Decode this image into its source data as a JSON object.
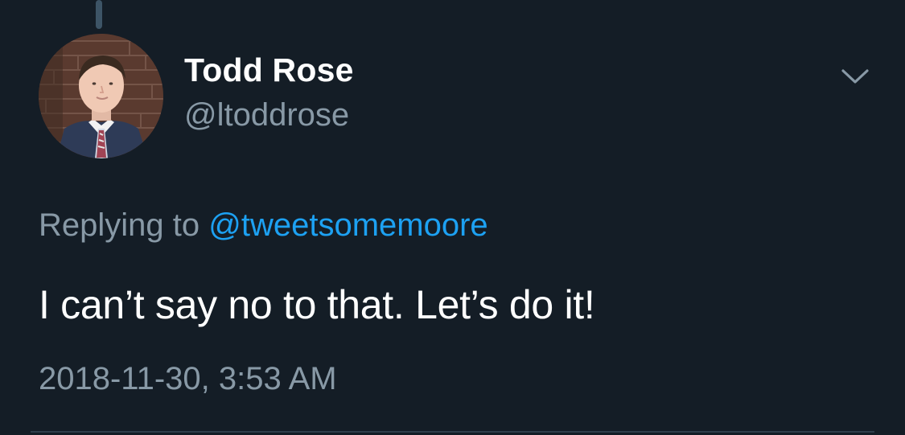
{
  "tweet": {
    "author": {
      "name": "Todd Rose",
      "handle": "@ltoddrose"
    },
    "reply": {
      "prefix": "Replying to",
      "handle": "@tweetsomemoore"
    },
    "text": "I can’t say no to that. Let’s do it!",
    "timestamp": "2018-11-30, 3:53 AM"
  },
  "icons": {
    "menu": "chevron-down-icon"
  },
  "colors": {
    "background": "#141d26",
    "primary_text": "#ffffff",
    "secondary_text": "#8899a6",
    "accent": "#1da1f2",
    "divider": "#2f3e4c",
    "thread_line": "#3d5466"
  }
}
